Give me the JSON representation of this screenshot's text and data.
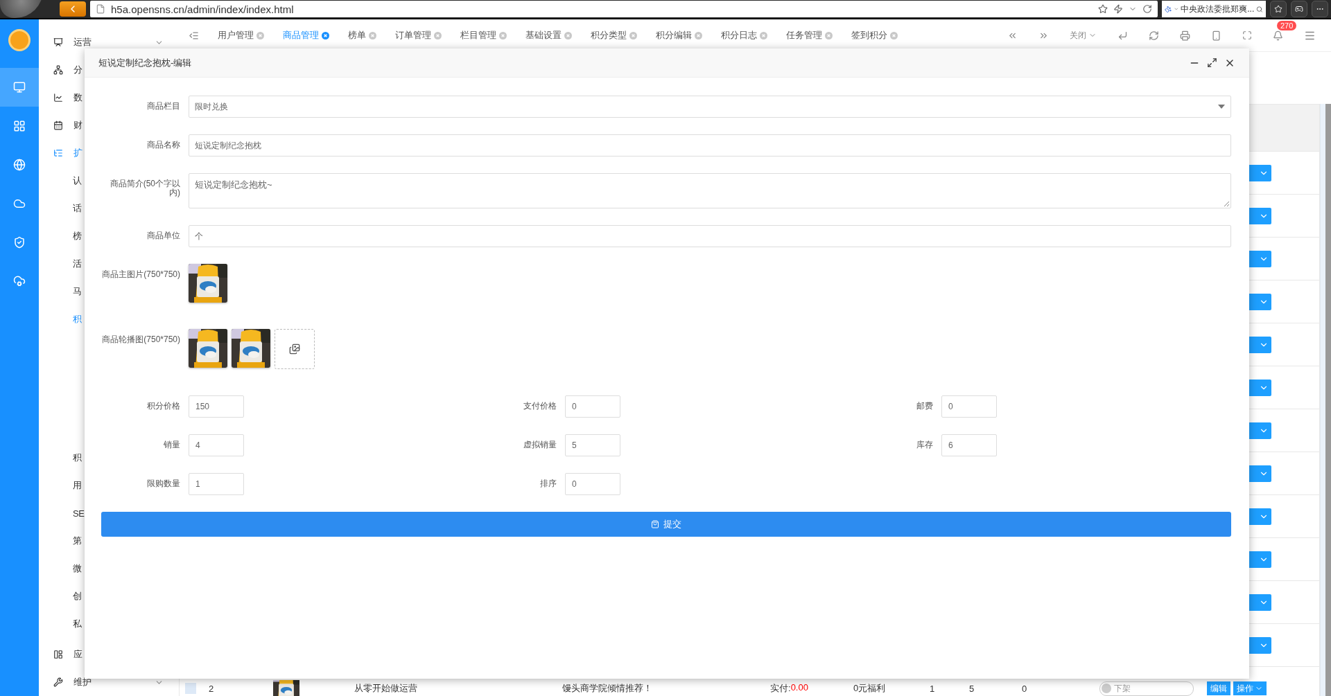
{
  "browser": {
    "url": "h5a.opensns.cn/admin/index/index.html",
    "search": "中央政法委批郑爽..."
  },
  "rail": {
    "items": [
      {
        "selected": true
      },
      {
        "selected": false
      },
      {
        "selected": false
      },
      {
        "selected": false
      },
      {
        "selected": false
      },
      {
        "selected": false
      }
    ]
  },
  "sidebar": {
    "items": [
      {
        "kind": "group",
        "label": "运营",
        "selected": false,
        "expanded": false
      },
      {
        "kind": "group",
        "label": "分",
        "selected": false
      },
      {
        "kind": "group",
        "label": "数",
        "selected": false
      },
      {
        "kind": "group",
        "label": "财",
        "selected": false
      },
      {
        "kind": "group",
        "label": "扩",
        "selected": true
      },
      {
        "kind": "sub",
        "label": "认",
        "selected": false
      },
      {
        "kind": "sub",
        "label": "话",
        "selected": false
      },
      {
        "kind": "sub",
        "label": "榜",
        "selected": false
      },
      {
        "kind": "sub",
        "label": "活",
        "selected": false
      },
      {
        "kind": "sub",
        "label": "马",
        "selected": false
      },
      {
        "kind": "sub",
        "label": "积",
        "selected": true,
        "expanded": true
      },
      {
        "kind": "sub",
        "label": "积",
        "selected": false
      },
      {
        "kind": "sub",
        "label": "用",
        "selected": false
      },
      {
        "kind": "sub",
        "label": "SE",
        "selected": false
      },
      {
        "kind": "sub",
        "label": "第",
        "selected": false
      },
      {
        "kind": "sub",
        "label": "微",
        "selected": false
      },
      {
        "kind": "sub",
        "label": "创",
        "selected": false
      },
      {
        "kind": "sub",
        "label": "私",
        "selected": false
      },
      {
        "kind": "group",
        "label": "应",
        "selected": false
      },
      {
        "kind": "group",
        "label": "维护",
        "selected": false,
        "expanded": false
      }
    ]
  },
  "tabs": [
    {
      "label": "用户管理",
      "selected": false
    },
    {
      "label": "商品管理",
      "selected": true
    },
    {
      "label": "榜单",
      "selected": false
    },
    {
      "label": "订单管理",
      "selected": false
    },
    {
      "label": "栏目管理",
      "selected": false
    },
    {
      "label": "基础设置",
      "selected": false
    },
    {
      "label": "积分类型",
      "selected": false
    },
    {
      "label": "积分编辑",
      "selected": false
    },
    {
      "label": "积分日志",
      "selected": false
    },
    {
      "label": "任务管理",
      "selected": false
    },
    {
      "label": "签到积分",
      "selected": false
    }
  ],
  "toolbar": {
    "close_label": "关闭",
    "notifications": "270"
  },
  "table": {
    "rows": [
      {
        "kind": "covered"
      },
      {
        "kind": "covered"
      },
      {
        "kind": "covered"
      },
      {
        "kind": "covered"
      },
      {
        "kind": "covered"
      },
      {
        "kind": "covered"
      },
      {
        "kind": "covered"
      },
      {
        "kind": "covered"
      },
      {
        "kind": "covered"
      },
      {
        "kind": "covered"
      },
      {
        "kind": "covered"
      },
      {
        "kind": "covered"
      },
      {
        "kind": "partial",
        "checked": false,
        "index": "2",
        "title": "从零开始做运营",
        "subtitle": "馒头商学院倾情推荐！",
        "price_label": "实付:",
        "price": "0.00",
        "benefit": "0元福利",
        "col_1": "1",
        "col_2": "5",
        "col_3": "0",
        "status": "下架",
        "on": false,
        "edit": "编辑",
        "action": "操作"
      }
    ]
  },
  "modal": {
    "title": "短说定制纪念抱枕-编辑",
    "fields": [
      {
        "kind": "select",
        "label": "商品栏目",
        "value": "限时兑换"
      },
      {
        "kind": "text",
        "label": "商品名称",
        "value": "短说定制纪念抱枕"
      },
      {
        "kind": "textarea",
        "label": "商品简介(50个字以内)",
        "value": "短说定制纪念抱枕~"
      },
      {
        "kind": "text",
        "label": "商品单位",
        "value": "个"
      },
      {
        "kind": "images",
        "label": "商品主图片(750*750)",
        "upload": false
      },
      {
        "kind": "images",
        "label": "商品轮播图(750*750)",
        "upload": true
      }
    ],
    "grid_rows": [
      [
        {
          "label": "积分价格",
          "value": "150"
        },
        {
          "label": "支付价格",
          "value": "0"
        },
        {
          "label": "邮费",
          "value": "0"
        }
      ],
      [
        {
          "label": "销量",
          "value": "4"
        },
        {
          "label": "虚拟销量",
          "value": "5"
        },
        {
          "label": "库存",
          "value": "6"
        }
      ],
      [
        {
          "label": "限购数量",
          "value": "1"
        },
        {
          "label": "排序",
          "value": "0"
        }
      ]
    ],
    "submit": "提交"
  }
}
